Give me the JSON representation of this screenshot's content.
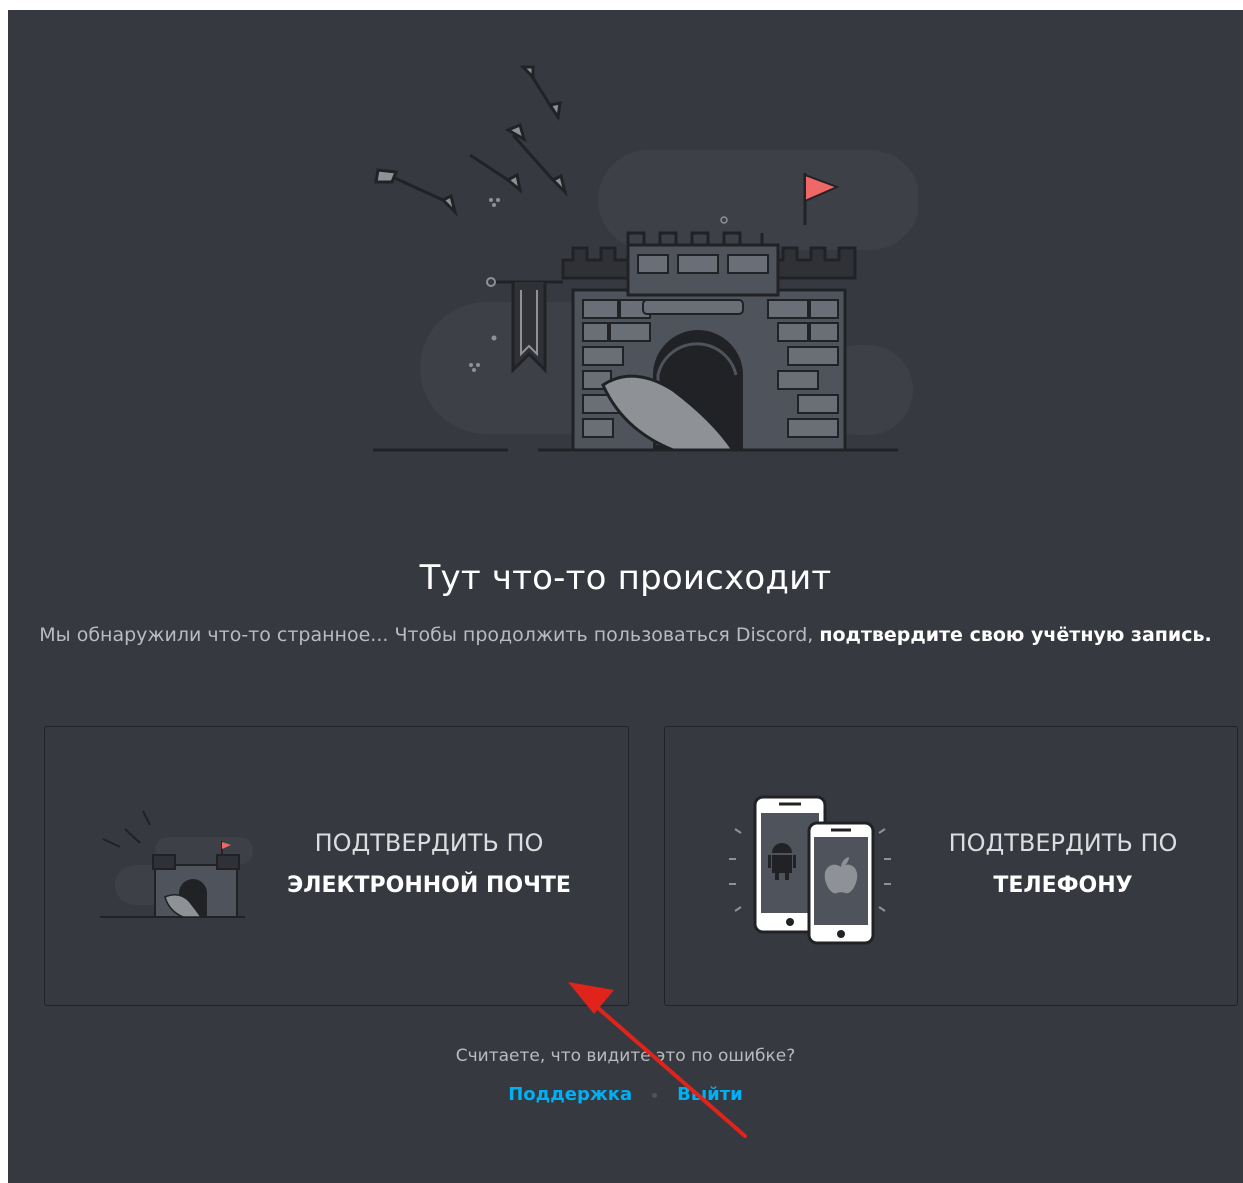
{
  "page": {
    "title": "Тут что-то происходит",
    "description_plain": "Мы обнаружили что-то странное... Чтобы продолжить пользоваться Discord, ",
    "description_bold": "подтвердите свою учётную запись."
  },
  "options": {
    "email": {
      "line1": "ПОДТВЕРДИТЬ ПО",
      "line2": "ЭЛЕКТРОННОЙ ПОЧТЕ"
    },
    "phone": {
      "line1": "ПОДТВЕРДИТЬ ПО",
      "line2": "ТЕЛЕФОНУ"
    }
  },
  "footer": {
    "question": "Считаете, что видите это по ошибке?",
    "support_label": "Поддержка",
    "logout_label": "Выйти"
  },
  "icons": {
    "hero": "castle-illustration",
    "email": "castle-icon",
    "phone": "phones-icon",
    "annotation": "red-arrow-icon"
  },
  "colors": {
    "background": "#36393f",
    "card_border": "#202225",
    "link": "#00b0f4",
    "flag": "#f06767",
    "arrow": "#e0231b"
  }
}
